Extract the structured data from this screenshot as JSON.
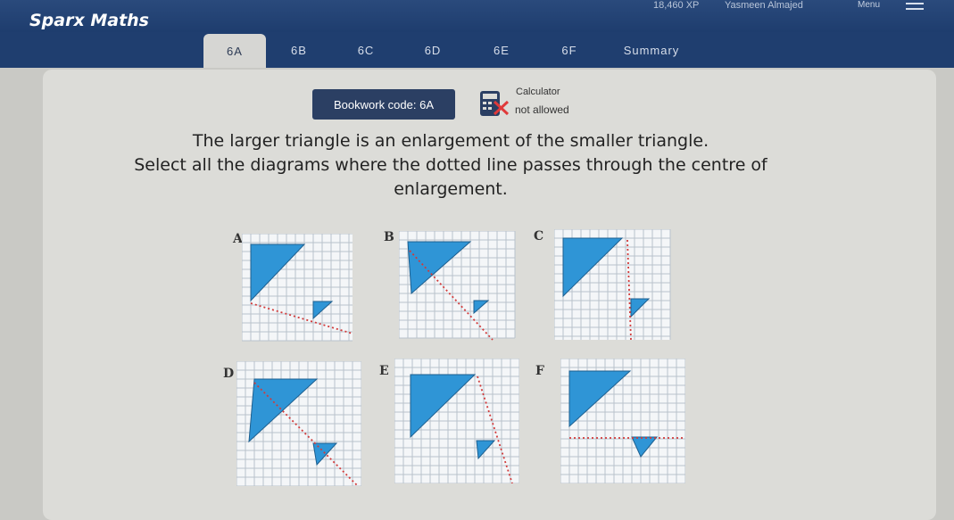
{
  "header": {
    "brand": "Sparx Maths",
    "xp": "18,460 XP",
    "user": "Yasmeen Almajed",
    "menu_label": "Menu"
  },
  "tabs": [
    {
      "label": "6A",
      "active": true
    },
    {
      "label": "6B",
      "active": false
    },
    {
      "label": "6C",
      "active": false
    },
    {
      "label": "6D",
      "active": false
    },
    {
      "label": "6E",
      "active": false
    },
    {
      "label": "6F",
      "active": false
    },
    {
      "label": "Summary",
      "active": false
    }
  ],
  "bookwork": {
    "label": "Bookwork code: 6A"
  },
  "calculator": {
    "title": "Calculator",
    "status": "not allowed",
    "icon": "calculator-crossed-icon"
  },
  "question": {
    "line1": "The larger triangle is an enlargement of the smaller triangle.",
    "line2": "Select all the diagrams where the dotted line passes through the centre of",
    "line3": "enlargement."
  },
  "options": [
    {
      "label": "A"
    },
    {
      "label": "B"
    },
    {
      "label": "C"
    },
    {
      "label": "D"
    },
    {
      "label": "E"
    },
    {
      "label": "F"
    }
  ],
  "colors": {
    "header": "#1e3d6e",
    "tab_active": "#d6d6d3",
    "triangle_fill": "#2f95d6",
    "dotted_line": "#d13b3b",
    "bookwork_bg": "#2b3f63"
  }
}
